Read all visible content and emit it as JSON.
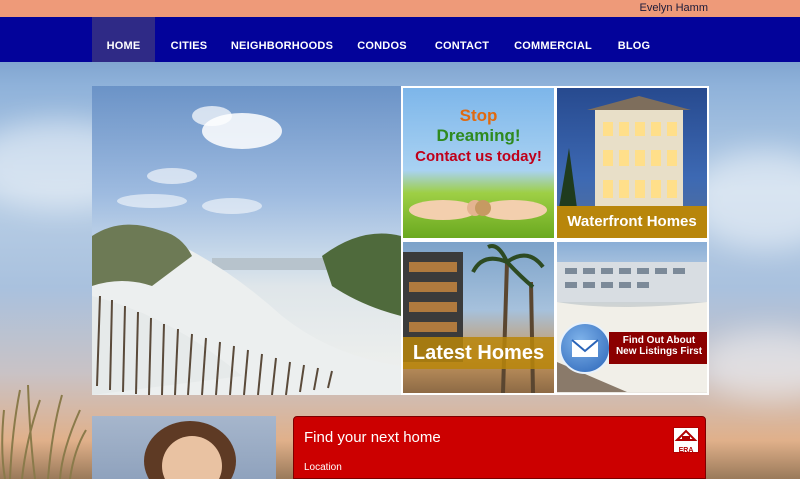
{
  "header": {
    "user_name": "Evelyn Hamm"
  },
  "nav": {
    "items": [
      {
        "label": "HOME",
        "active": true
      },
      {
        "label": "CITIES",
        "active": false
      },
      {
        "label": "NEIGHBORHOODS",
        "active": false
      },
      {
        "label": "CONDOS",
        "active": false
      },
      {
        "label": "CONTACT",
        "active": false
      },
      {
        "label": "COMMERCIAL",
        "active": false
      },
      {
        "label": "BLOG",
        "active": false
      }
    ]
  },
  "promos": {
    "contact": {
      "line1": "Stop",
      "line2": "Dreaming!",
      "line3": "Contact us today!"
    },
    "waterfront": {
      "label": "Waterfront Homes"
    },
    "latest": {
      "label": "Latest Homes"
    },
    "listings": {
      "line1": "Find Out About",
      "line2": "New Listings First"
    }
  },
  "search": {
    "title": "Find your next home",
    "location_label": "Location",
    "logo_text": "ERA"
  },
  "colors": {
    "topbar": "#ee9a79",
    "nav": "#03039a",
    "nav_active": "#2f2a86",
    "search_panel": "#cc0000",
    "label_bar_gold": "#b8860b",
    "label_bar_red": "#8b0000"
  }
}
